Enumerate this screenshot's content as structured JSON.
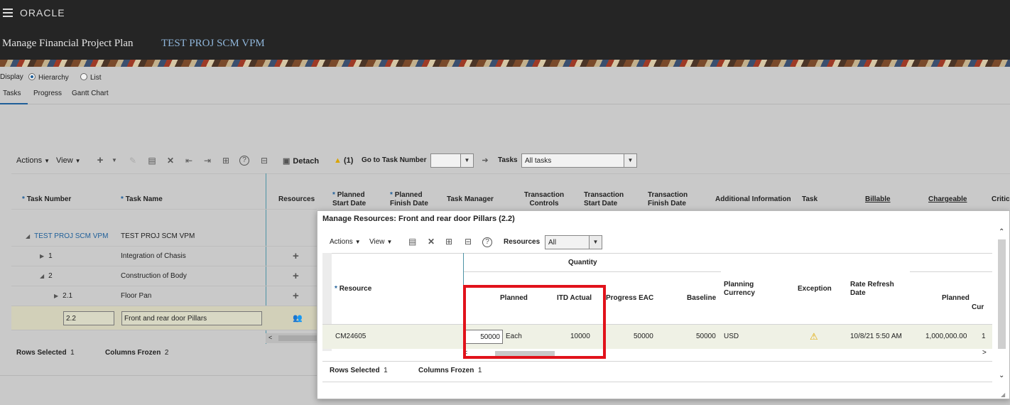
{
  "header": {
    "logo": "ORACLE",
    "page_title": "Manage Financial Project Plan",
    "project": "TEST PROJ SCM VPM"
  },
  "display": {
    "label": "Display",
    "options": [
      "Hierarchy",
      "List"
    ],
    "selected": "Hierarchy"
  },
  "tabs": [
    "Tasks",
    "Progress",
    "Gantt Chart"
  ],
  "toolbar": {
    "actions": "Actions",
    "view": "View",
    "detach": "Detach",
    "warnings": "(1)",
    "goto_label": "Go to Task Number",
    "goto_value": "",
    "tasks_label": "Tasks",
    "tasks_filter": "All tasks"
  },
  "task_table": {
    "columns": [
      "Task Number",
      "Task Name",
      "Resources",
      "Planned Start Date",
      "Planned Finish Date",
      "Task Manager",
      "Transaction Controls",
      "Transaction Start Date",
      "Transaction Finish Date",
      "Additional Information",
      "Task",
      "Billable",
      "Chargeable",
      "Critic"
    ],
    "rows": [
      {
        "number": "TEST PROJ SCM VPM",
        "name": "TEST PROJ SCM VPM"
      },
      {
        "number": "1",
        "name": "Integration of Chasis"
      },
      {
        "number": "2",
        "name": "Construction of Body"
      },
      {
        "number": "2.1",
        "name": "Floor Pan"
      },
      {
        "number": "2.2",
        "name": "Front and rear door Pillars"
      }
    ],
    "footer": {
      "rows_selected_label": "Rows Selected",
      "rows_selected": "1",
      "cols_frozen_label": "Columns Frozen",
      "cols_frozen": "2"
    }
  },
  "dialog": {
    "title": "Manage Resources: Front and rear door Pillars (2.2)",
    "toolbar": {
      "actions": "Actions",
      "view": "View",
      "resources_label": "Resources",
      "resources_value": "All"
    },
    "group_header": "Quantity",
    "columns": {
      "resource": "Resource",
      "planned": "Planned",
      "itd_actual": "ITD Actual",
      "progress_eac": "Progress EAC",
      "baseline": "Baseline",
      "planning_currency": "Planning Currency",
      "exception": "Exception",
      "rate_refresh": "Rate Refresh Date",
      "planned2": "Planned",
      "cur": "Cur"
    },
    "row": {
      "resource": "CM24605",
      "planned": "50000",
      "uom": "Each",
      "itd_actual": "10000",
      "progress_eac": "50000",
      "baseline": "50000",
      "currency": "USD",
      "rate_refresh": "10/8/21 5:50 AM",
      "planned_amount": "1,000,000.00",
      "cur": "1"
    },
    "footer": {
      "rows_selected_label": "Rows Selected",
      "rows_selected": "1",
      "cols_frozen_label": "Columns Frozen",
      "cols_frozen": "1"
    }
  },
  "colors": {
    "highlight_box": "#e1121b",
    "accent": "#1f5f99",
    "topbar": "#252525"
  }
}
